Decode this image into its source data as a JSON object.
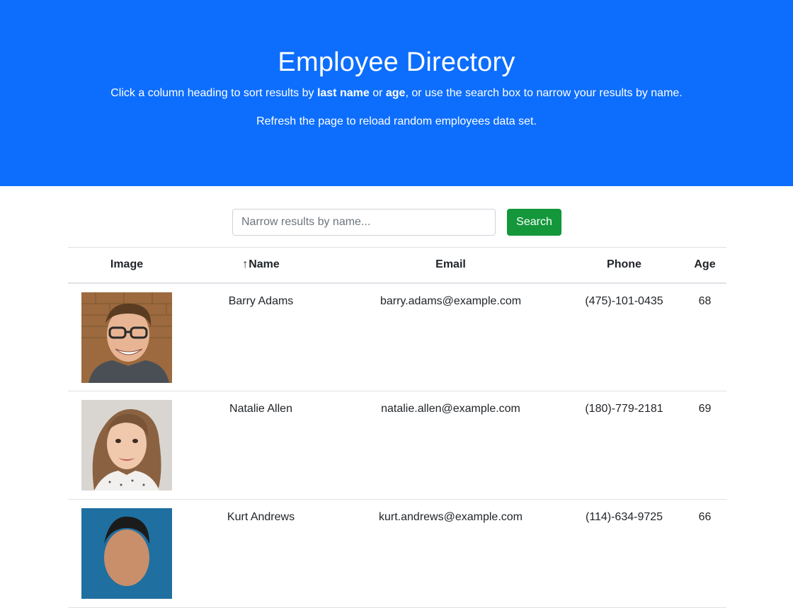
{
  "header": {
    "title": "Employee Directory",
    "instructions_prefix": "Click a column heading to sort results by ",
    "instructions_bold1": "last name",
    "instructions_mid": " or ",
    "instructions_bold2": "age",
    "instructions_suffix": ", or use the search box to narrow your results by name.",
    "refresh_note": "Refresh the page to reload random employees data set."
  },
  "search": {
    "placeholder": "Narrow results by name...",
    "value": "",
    "button_label": "Search"
  },
  "table": {
    "columns": {
      "image": "Image",
      "name": "Name",
      "email": "Email",
      "phone": "Phone",
      "age": "Age"
    },
    "sort_arrow": "↑",
    "rows": [
      {
        "name": "Barry Adams",
        "email": "barry.adams@example.com",
        "phone": "(475)-101-0435",
        "age": "68"
      },
      {
        "name": "Natalie Allen",
        "email": "natalie.allen@example.com",
        "phone": "(180)-779-2181",
        "age": "69"
      },
      {
        "name": "Kurt Andrews",
        "email": "kurt.andrews@example.com",
        "phone": "(114)-634-9725",
        "age": "66"
      }
    ]
  },
  "colors": {
    "header_bg": "#0d6efd",
    "search_button": "#13973a"
  }
}
